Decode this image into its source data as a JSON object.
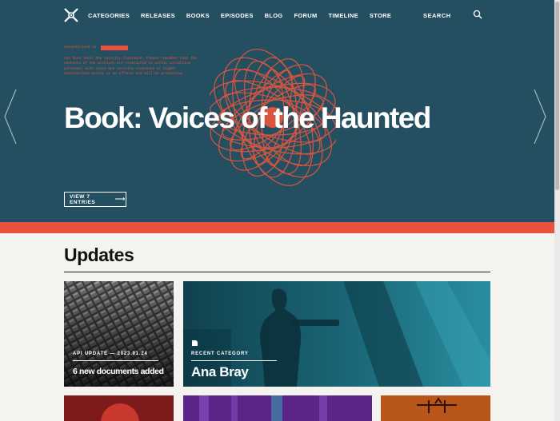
{
  "nav": {
    "items": [
      "CATEGORIES",
      "RELEASES",
      "BOOKS",
      "EPISODES",
      "BLOG",
      "FORUM",
      "TIMELINE",
      "STORE"
    ],
    "search_label": "SEARCH"
  },
  "hero": {
    "redacted_label": "Unauthorized as",
    "warning": "You have level One security clearance. Please remember that the contents of the archives are restricted to Lethic Collective personnel with level One security clearance or higher. Unauthorized access is an offense and will be prosecuted.",
    "title": "Book: Voices of the Haunted",
    "button_label": "VIEW 7 ENTRIES",
    "colors": {
      "background": "#244f60",
      "accent": "#e8523f"
    }
  },
  "updates": {
    "title": "Updates",
    "cards": [
      {
        "meta": "API UPDATE — 2023.01.24",
        "title": "6 new documents added"
      },
      {
        "meta": "RECENT CATEGORY",
        "title": "Ana Bray"
      }
    ]
  },
  "icons": {
    "logo": "lethic-logo-icon",
    "search": "search-icon",
    "prev": "chevron-left-icon",
    "next": "chevron-right-icon",
    "arrow": "arrow-right-icon",
    "category": "document-icon"
  }
}
